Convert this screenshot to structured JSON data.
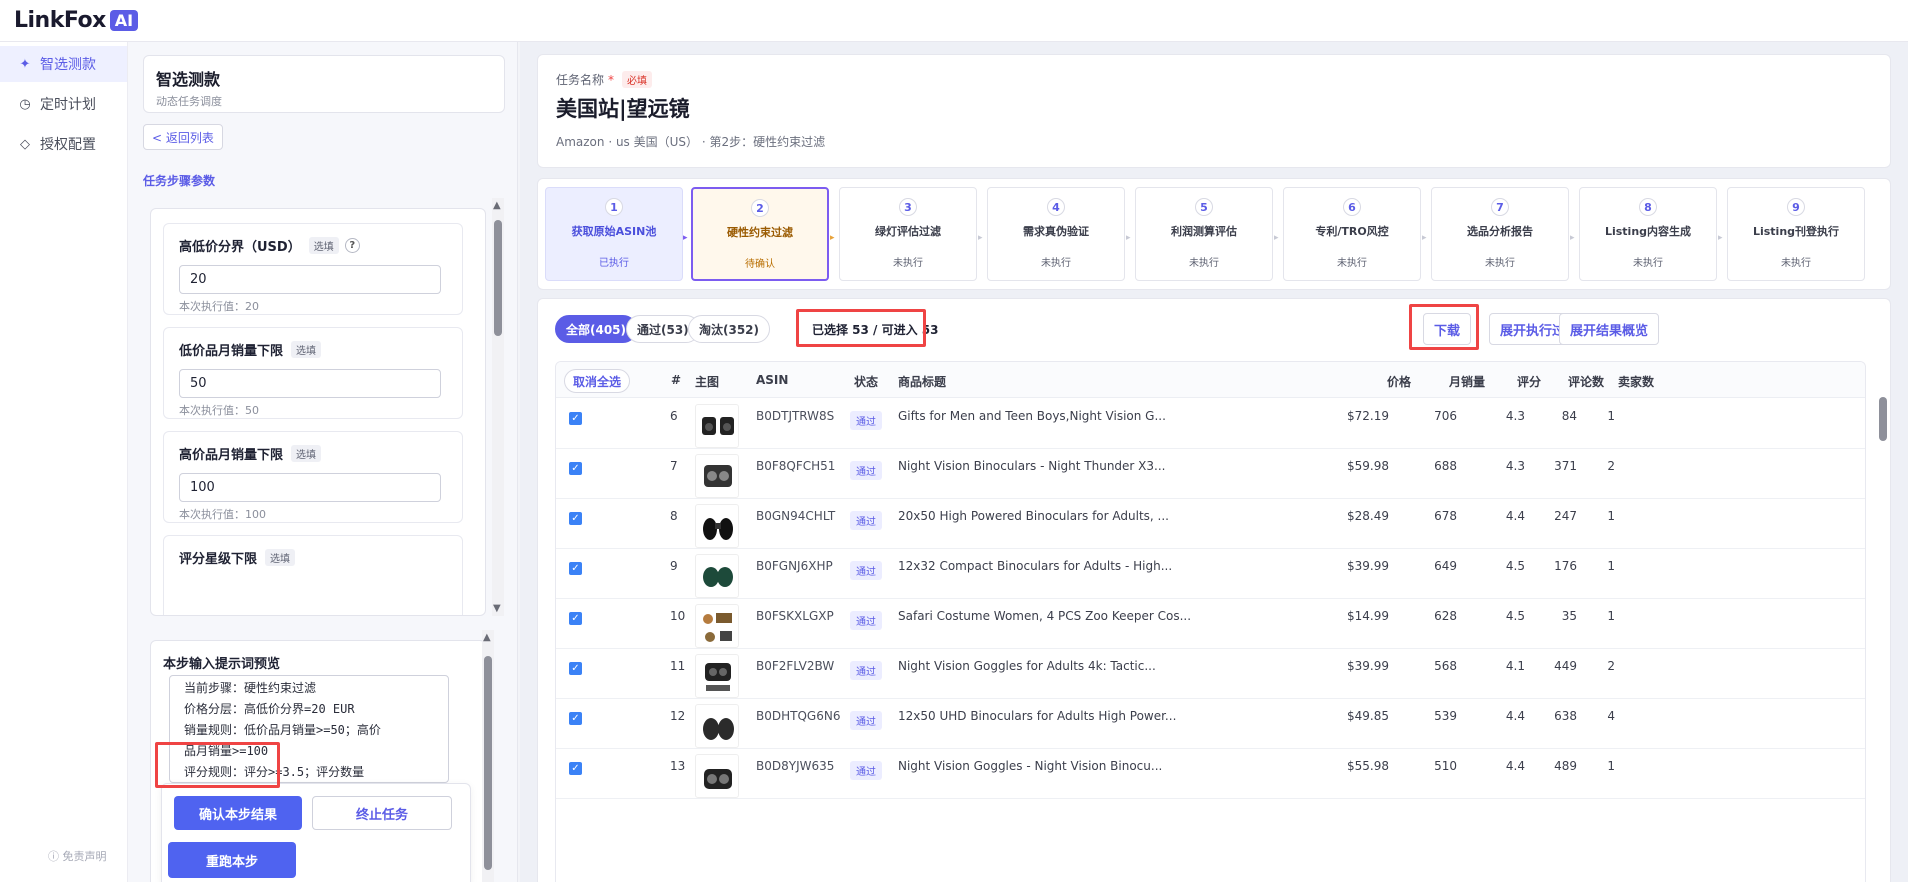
{
  "app": {
    "logo_text": "LinkFox",
    "logo_badge": "AI"
  },
  "nav": {
    "items": [
      {
        "label": "智选测款",
        "icon": "sparkle-icon",
        "active": true
      },
      {
        "label": "定时计划",
        "icon": "clock-icon",
        "active": false
      },
      {
        "label": "授权配置",
        "icon": "diamond-icon",
        "active": false
      }
    ],
    "disclaimer": "ⓘ 免责声明"
  },
  "panel": {
    "title": "智选测款",
    "subtitle": "动态任务调度",
    "back_label": "< 返回列表",
    "section_label": "任务步骤参数",
    "params": [
      {
        "label": "高低价分界（USD）",
        "tag": "选填",
        "help": "?",
        "value": "20",
        "hint": "本次执行值：20"
      },
      {
        "label": "低价品月销量下限",
        "tag": "选填",
        "value": "50",
        "hint": "本次执行值：50"
      },
      {
        "label": "高价品月销量下限",
        "tag": "选填",
        "value": "100",
        "hint": "本次执行值：100"
      },
      {
        "label": "评分星级下限",
        "tag": "选填"
      }
    ],
    "prompt_title": "本步输入提示词预览",
    "prompt_lines": [
      "当前步骤：硬性约束过滤",
      "价格分层：高低价分界=20 EUR",
      "销量规则：低价品月销量>=50；高价",
      "品月销量>=100",
      "评分规则：评分>=3.5；评分数量"
    ],
    "confirm_label": "确认本步结果",
    "stop_label": "终止任务",
    "rerun_label": "重跑本步"
  },
  "task": {
    "name_label": "任务名称",
    "required_star": "*",
    "required_tag": "必填",
    "name": "美国站|望远镜",
    "meta": "Amazon · us 美国（US） · 第2步：硬性约束过滤"
  },
  "steps": [
    {
      "num": "1",
      "name": "获取原始ASIN池",
      "status": "已执行",
      "state": "done"
    },
    {
      "num": "2",
      "name": "硬性约束过滤",
      "status": "待确认",
      "state": "current"
    },
    {
      "num": "3",
      "name": "绿灯评估过滤",
      "status": "未执行",
      "state": "pending"
    },
    {
      "num": "4",
      "name": "需求真伪验证",
      "status": "未执行",
      "state": "pending"
    },
    {
      "num": "5",
      "name": "利润测算评估",
      "status": "未执行",
      "state": "pending"
    },
    {
      "num": "6",
      "name": "专利/TRO风控",
      "status": "未执行",
      "state": "pending"
    },
    {
      "num": "7",
      "name": "选品分析报告",
      "status": "未执行",
      "state": "pending"
    },
    {
      "num": "8",
      "name": "Listing内容生成",
      "status": "未执行",
      "state": "pending"
    },
    {
      "num": "9",
      "name": "Listing刊登执行",
      "status": "未执行",
      "state": "pending"
    }
  ],
  "filters": {
    "all": "全部(405)",
    "pass": "通过(53)",
    "fail": "淘汰(352)"
  },
  "selection_info": "已选择 53 / 可进入 53",
  "actions": {
    "download": "下载",
    "expand_process": "展开执行过程",
    "expand_overview": "展开结果概览"
  },
  "table": {
    "deselect_all": "取消全选",
    "headers": {
      "idx": "#",
      "image": "主图",
      "asin": "ASIN",
      "status": "状态",
      "title": "商品标题",
      "price": "价格",
      "sales": "月销量",
      "rating": "评分",
      "reviews": "评论数",
      "sellers": "卖家数"
    },
    "rows": [
      {
        "idx": "6",
        "asin": "B0DTJTRW8S",
        "status": "通过",
        "title": "Gifts for Men and Teen Boys,Night Vision G...",
        "price": "$72.19",
        "sales": "706",
        "rating": "4.3",
        "reviews": "84",
        "sellers": "1"
      },
      {
        "idx": "7",
        "asin": "B0F8QFCH51",
        "status": "通过",
        "title": "Night Vision Binoculars - Night Thunder X3...",
        "price": "$59.98",
        "sales": "688",
        "rating": "4.3",
        "reviews": "371",
        "sellers": "2"
      },
      {
        "idx": "8",
        "asin": "B0GN94CHLT",
        "status": "通过",
        "title": "20x50 High Powered Binoculars for Adults, ...",
        "price": "$28.49",
        "sales": "678",
        "rating": "4.4",
        "reviews": "247",
        "sellers": "1"
      },
      {
        "idx": "9",
        "asin": "B0FGNJ6XHP",
        "status": "通过",
        "title": "12x32 Compact Binoculars for Adults - High...",
        "price": "$39.99",
        "sales": "649",
        "rating": "4.5",
        "reviews": "176",
        "sellers": "1"
      },
      {
        "idx": "10",
        "asin": "B0FSKXLGXP",
        "status": "通过",
        "title": "Safari Costume Women, 4 PCS Zoo Keeper Cos...",
        "price": "$14.99",
        "sales": "628",
        "rating": "4.5",
        "reviews": "35",
        "sellers": "1"
      },
      {
        "idx": "11",
        "asin": "B0F2FLV2BW",
        "status": "通过",
        "title": "Night Vision Goggles for Adults 4k: Tactic...",
        "price": "$39.99",
        "sales": "568",
        "rating": "4.1",
        "reviews": "449",
        "sellers": "2"
      },
      {
        "idx": "12",
        "asin": "B0DHTQG6N6",
        "status": "通过",
        "title": "12x50 UHD Binoculars for Adults High Power...",
        "price": "$49.85",
        "sales": "539",
        "rating": "4.4",
        "reviews": "638",
        "sellers": "4"
      },
      {
        "idx": "13",
        "asin": "B0D8YJW635",
        "status": "通过",
        "title": "Night Vision Goggles - Night Vision Binocu...",
        "price": "$55.98",
        "sales": "510",
        "rating": "4.4",
        "reviews": "489",
        "sellers": "1"
      }
    ]
  }
}
